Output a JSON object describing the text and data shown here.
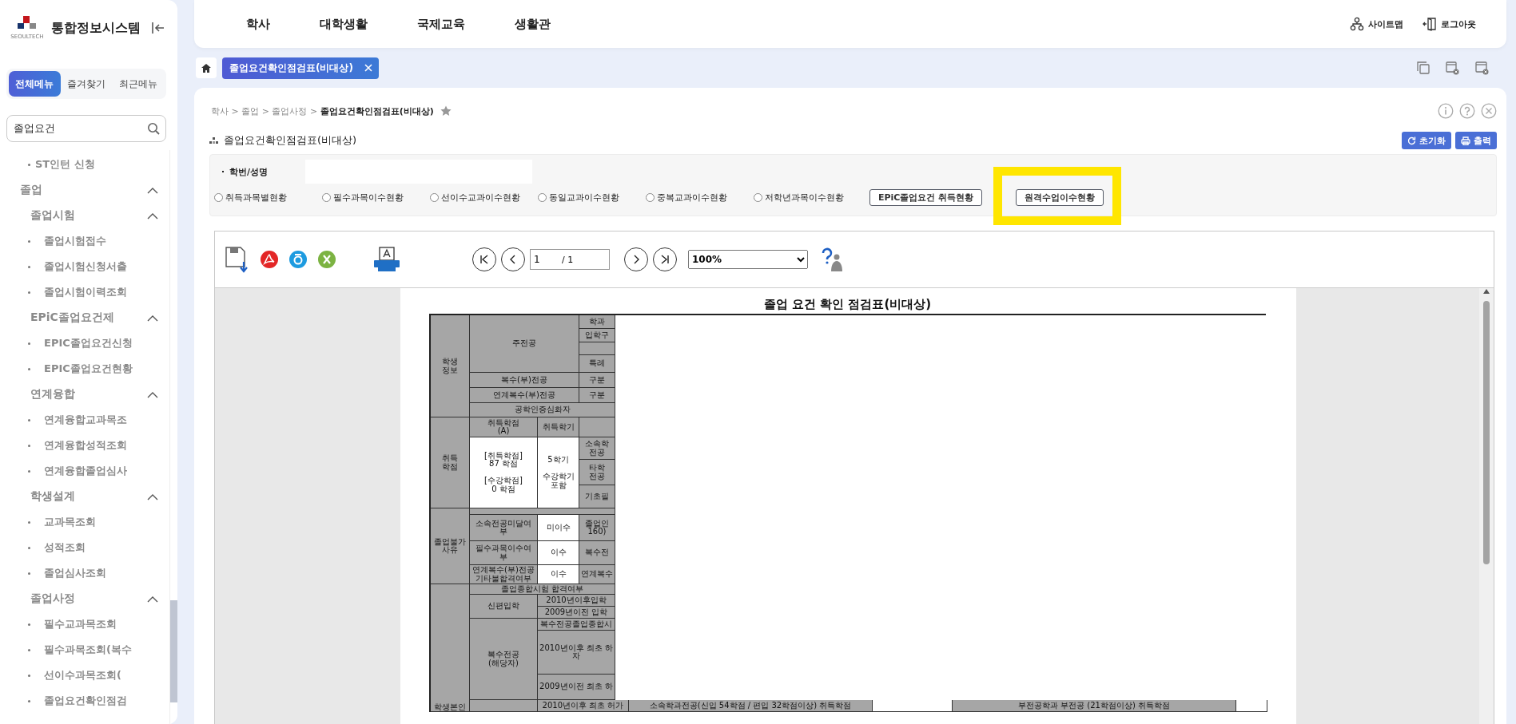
{
  "sidebar": {
    "title": "통합정보시스템",
    "logo_caption": "SEOULTECH",
    "tabs": [
      {
        "label": "전체메뉴",
        "selected": true
      },
      {
        "label": "즐겨찾기",
        "selected": false
      },
      {
        "label": "최근메뉴",
        "selected": false
      }
    ],
    "search": {
      "value": "졸업요건"
    },
    "menu": [
      {
        "label": "ST인턴 신청"
      },
      {
        "label": "졸업",
        "expanded": true,
        "children": [
          {
            "label": "졸업시험",
            "expanded": true,
            "children": [
              {
                "label": "졸업시험접수"
              },
              {
                "label": "졸업시험신청서출"
              },
              {
                "label": "졸업시험이력조회"
              }
            ]
          },
          {
            "label": "EPiC졸업요건제",
            "expanded": true,
            "children": [
              {
                "label": "EPIC졸업요건신청"
              },
              {
                "label": "EPIC졸업요건현황"
              }
            ]
          },
          {
            "label": "연계융합",
            "expanded": true,
            "children": [
              {
                "label": "연계융합교과목조"
              },
              {
                "label": "연계융합성적조회"
              },
              {
                "label": "연계융합졸업심사"
              }
            ]
          },
          {
            "label": "학생설계",
            "expanded": true,
            "children": [
              {
                "label": "교과목조회"
              },
              {
                "label": "성적조회"
              },
              {
                "label": "졸업심사조회"
              }
            ]
          },
          {
            "label": "졸업사정",
            "expanded": true,
            "children": [
              {
                "label": "필수교과목조회"
              },
              {
                "label": "필수과목조회(복수"
              },
              {
                "label": "선이수과목조회("
              },
              {
                "label": "졸업요건확인점검"
              }
            ]
          }
        ]
      }
    ]
  },
  "top_nav": {
    "items": [
      "학사",
      "대학생활",
      "국제교육",
      "생활관"
    ],
    "actions": [
      "사이트맵",
      "로그아웃"
    ]
  },
  "open_tabs": [
    {
      "label": "졸업요건확인점검표(비대상)",
      "selected": true
    }
  ],
  "breadcrumb": "학사 > 졸업 > 졸업사정 > **졸업요건확인점검표(비대상)**",
  "page_title": "졸업요건확인점검표(비대상)",
  "header_buttons": [
    "초기화",
    "출력"
  ],
  "search_form": {
    "label": "학번/성명",
    "options": [
      {
        "label": "취득과목별현황",
        "selected": false
      },
      {
        "label": "필수과목이수현황",
        "selected": false
      },
      {
        "label": "선이수교과이수현황",
        "selected": false
      },
      {
        "label": "동일교과이수현황",
        "selected": false
      },
      {
        "label": "중복교과이수현황",
        "selected": false
      },
      {
        "label": "저학년과목이수현황",
        "selected": false
      }
    ],
    "buttons": [
      {
        "label": "EPiC졸업요건 취득현황",
        "highlighted": false
      },
      {
        "label": "원격수업이수현황",
        "highlighted": true
      }
    ]
  },
  "report": {
    "page": "1",
    "total": "/ 1",
    "zoom": "100%",
    "title": "졸업 요건 확인 점검표(비대상)",
    "cells": [
      {
        "kind": "header",
        "text": "학생\n정보"
      },
      {
        "kind": "header",
        "text": "주전공"
      },
      {
        "kind": "header",
        "text": "학과"
      },
      {
        "kind": "header",
        "text": "입학구"
      },
      {
        "kind": "header"
      },
      {
        "kind": "header",
        "text": "특례"
      },
      {
        "kind": "header",
        "text": "복수(부)전공"
      },
      {
        "kind": "header",
        "text": "구분"
      },
      {
        "kind": "header",
        "text": "연계복수(부)전공"
      },
      {
        "kind": "header",
        "text": "구분"
      },
      {
        "kind": "header",
        "text": "공학인증심화자"
      },
      {
        "kind": "header",
        "text": "취득\n학점"
      },
      {
        "kind": "header",
        "text": "취득학점\n(A)"
      },
      {
        "kind": "header",
        "text": "취득학기"
      },
      {
        "kind": "header"
      },
      {
        "kind": "value",
        "text": "[취득학점]\n87 학점\n\n[수강학점]\n0 학점"
      },
      {
        "kind": "value",
        "text": "5학기\n\n수강학기\n포함"
      },
      {
        "kind": "header",
        "text": "소속학\n전공"
      },
      {
        "kind": "header",
        "text": "타학\n전공"
      },
      {
        "kind": "header",
        "text": "기초필"
      },
      {
        "kind": "header",
        "text": "졸업불가\n사유"
      },
      {
        "kind": "header"
      },
      {
        "kind": "header",
        "text": "소속전공미달여\n부"
      },
      {
        "kind": "value",
        "text": "미이수"
      },
      {
        "kind": "header",
        "text": "졸업인\n160)"
      },
      {
        "kind": "header",
        "text": "필수과목이수여\n부"
      },
      {
        "kind": "value",
        "text": "이수"
      },
      {
        "kind": "header",
        "text": "복수전"
      },
      {
        "kind": "header",
        "text": "연계복수(부)전공\n기타불합격여부"
      },
      {
        "kind": "value",
        "text": "이수"
      },
      {
        "kind": "header",
        "text": "연계복수"
      },
      {
        "kind": "header",
        "text": "학생본인"
      },
      {
        "kind": "header",
        "text": "졸업종합시험 합격여부"
      },
      {
        "kind": "header",
        "text": "신편입학"
      },
      {
        "kind": "header",
        "text": "2010년이후입학"
      },
      {
        "kind": "header",
        "text": "2009년이전 입학"
      },
      {
        "kind": "header",
        "text": "복수전공\n(해당자)"
      },
      {
        "kind": "header",
        "text": "복수전공졸업종합시"
      },
      {
        "kind": "header",
        "text": "2010년이후 최초 하\n자"
      },
      {
        "kind": "header",
        "text": "2009년이전 최초 하"
      },
      {
        "kind": "header"
      },
      {
        "kind": "header",
        "text": "2010년이후 최초 허가"
      },
      {
        "kind": "header",
        "text": "소속학과전공(신입 54학점 / 편입 32학점이상) 취득학점"
      },
      {
        "kind": "value"
      },
      {
        "kind": "header",
        "text": "부전공학과 부전공 (21학점이상) 취득학점"
      },
      {
        "kind": "value"
      }
    ]
  }
}
